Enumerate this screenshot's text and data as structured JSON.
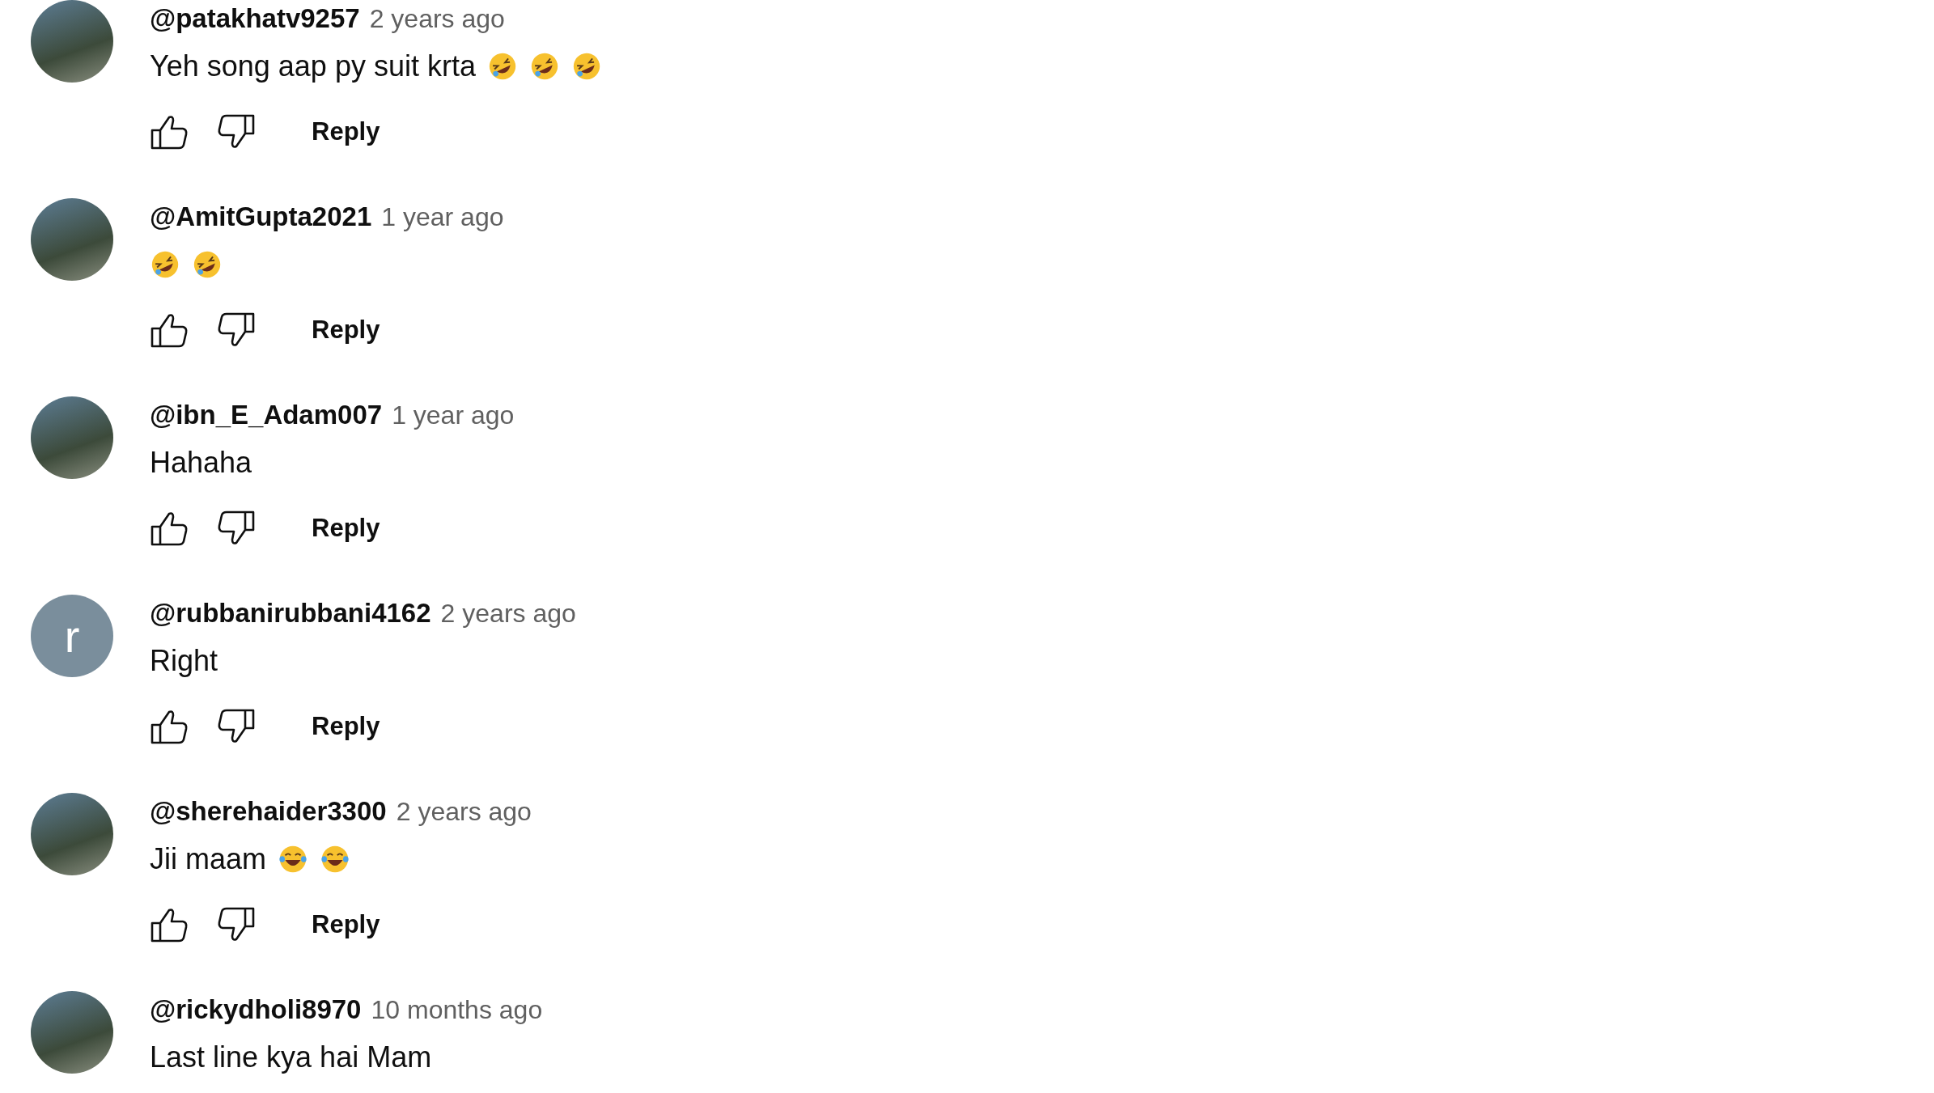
{
  "comments": [
    {
      "avatar": {
        "kind": "photo"
      },
      "author": "@patakhatv9257",
      "time": "2 years ago",
      "body": [
        {
          "kind": "text",
          "text": "Yeh song aap py suit krta"
        },
        {
          "kind": "rofl"
        },
        {
          "kind": "rofl"
        },
        {
          "kind": "rofl"
        }
      ],
      "reply": "Reply"
    },
    {
      "avatar": {
        "kind": "photo"
      },
      "author": "@AmitGupta2021",
      "time": "1 year ago",
      "body": [
        {
          "kind": "rofl"
        },
        {
          "kind": "rofl"
        }
      ],
      "reply": "Reply"
    },
    {
      "avatar": {
        "kind": "photo"
      },
      "author": "@ibn_E_Adam007",
      "time": "1 year ago",
      "body": [
        {
          "kind": "text",
          "text": "Hahaha"
        }
      ],
      "reply": "Reply"
    },
    {
      "avatar": {
        "kind": "letter",
        "letter": "r",
        "color": "#7a8e9c"
      },
      "author": "@rubbanirubbani4162",
      "time": "2 years ago",
      "body": [
        {
          "kind": "text",
          "text": "Right"
        }
      ],
      "reply": "Reply"
    },
    {
      "avatar": {
        "kind": "photo"
      },
      "author": "@sherehaider3300",
      "time": "2 years ago",
      "body": [
        {
          "kind": "text",
          "text": "Jii maam"
        },
        {
          "kind": "joy"
        },
        {
          "kind": "joy"
        }
      ],
      "reply": "Reply"
    },
    {
      "avatar": {
        "kind": "photo"
      },
      "author": "@rickydholi8970",
      "time": "10 months ago",
      "body": [
        {
          "kind": "text",
          "text": "Last line kya hai Mam"
        }
      ]
    }
  ]
}
